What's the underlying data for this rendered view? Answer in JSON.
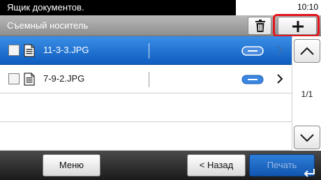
{
  "status_bar": {
    "title": "Ящик документов.",
    "time": "10:10"
  },
  "header": {
    "location": "Съемный носитель",
    "trash_icon": "trash-icon",
    "add_label": "+"
  },
  "files": [
    {
      "name": "11-3-3.JPG",
      "selected": true,
      "checked": false
    },
    {
      "name": "7-9-2.JPG",
      "selected": false,
      "checked": false
    }
  ],
  "scroll": {
    "page": "1/1",
    "up_icon": "chevron-up-icon",
    "down_icon": "chevron-down-icon"
  },
  "footer": {
    "menu_label": "Меню",
    "back_label": "< Назад",
    "print_label": "Печать",
    "enter_icon": "enter-icon"
  },
  "colors": {
    "selection": "#1a6fd3",
    "highlight": "#e3141b",
    "print_button": "#1f6ac4"
  }
}
